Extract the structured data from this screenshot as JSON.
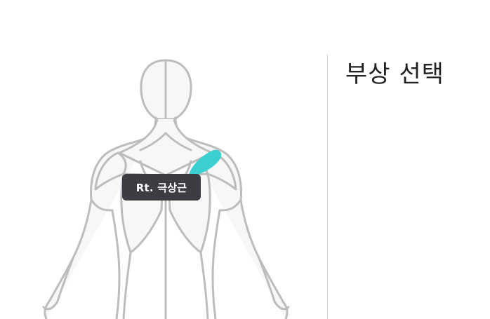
{
  "figure": {
    "selected_muscle": "Rt. 극상근",
    "view": "back",
    "colors": {
      "outline": "#bdbdbd",
      "fill": "#f7f7f7",
      "highlight": "#3ccfcf"
    }
  },
  "panel": {
    "title": "부상 선택"
  }
}
